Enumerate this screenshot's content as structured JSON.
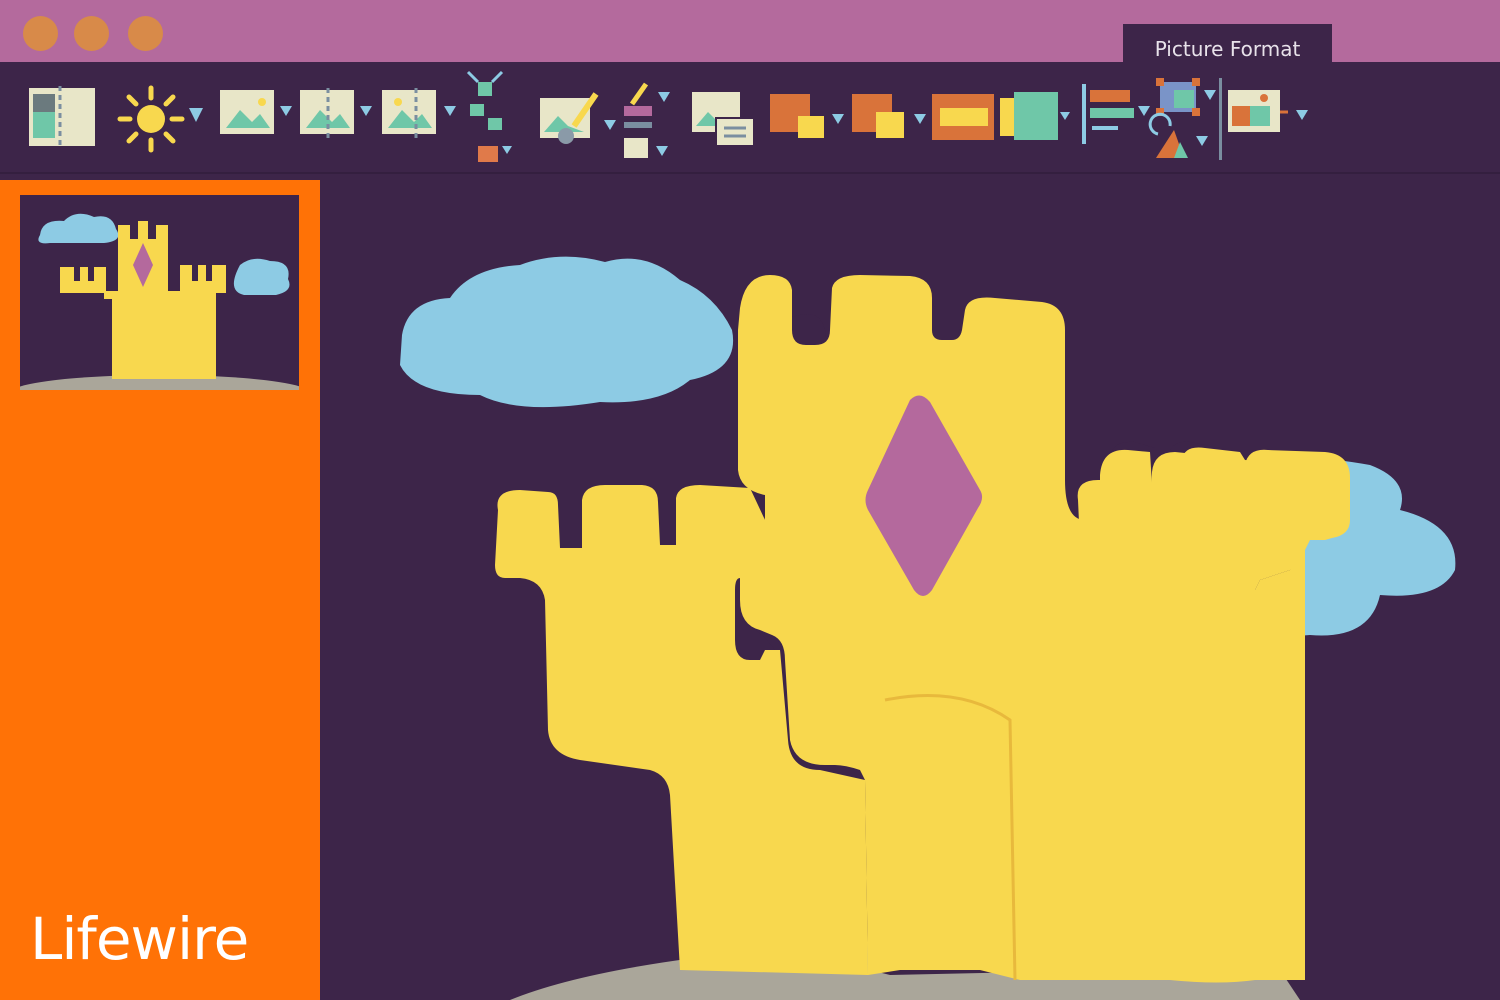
{
  "window": {
    "buttons": [
      "close",
      "minimize",
      "maximize"
    ],
    "active_tab": "Picture Format"
  },
  "ribbon": {
    "tools": [
      {
        "name": "remove-background-icon"
      },
      {
        "name": "corrections-icon"
      },
      {
        "name": "color-icon"
      },
      {
        "name": "artistic-effects-icon"
      },
      {
        "name": "transparency-icon"
      },
      {
        "name": "compress-pictures-icon"
      },
      {
        "name": "picture-styles-icon"
      },
      {
        "name": "picture-effects-icon"
      },
      {
        "name": "alt-text-icon"
      },
      {
        "name": "bring-forward-icon"
      },
      {
        "name": "send-backward-icon"
      },
      {
        "name": "selection-pane-icon"
      },
      {
        "name": "align-icon"
      },
      {
        "name": "group-icon"
      },
      {
        "name": "rotate-icon"
      },
      {
        "name": "crop-icon"
      }
    ]
  },
  "brand": {
    "text": "Lifewire"
  },
  "colors": {
    "titlebar": "#b46a9d",
    "background": "#3d2549",
    "panel": "#ff7206",
    "castle": "#f8d84e",
    "cloud": "#8dcbe4",
    "diamond": "#b4699d",
    "ground": "#aaa69a"
  }
}
